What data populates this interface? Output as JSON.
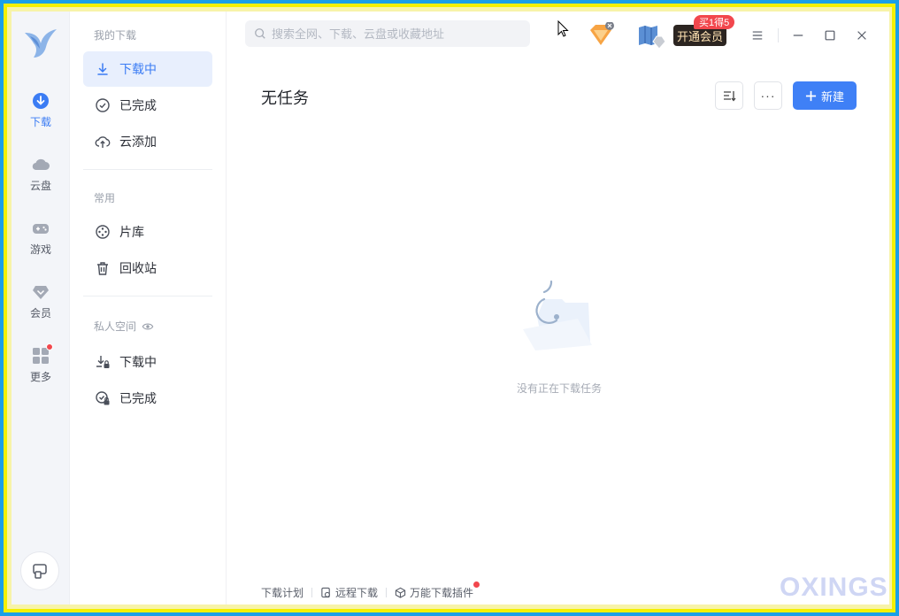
{
  "rail": {
    "items": [
      {
        "label": "下载",
        "icon": "download-circle-icon",
        "active": true
      },
      {
        "label": "云盘",
        "icon": "cloud-icon"
      },
      {
        "label": "游戏",
        "icon": "gamepad-icon"
      },
      {
        "label": "会员",
        "icon": "diamond-icon"
      },
      {
        "label": "更多",
        "icon": "apps-grid-icon",
        "badge_dot": true
      }
    ]
  },
  "side": {
    "my_downloads_title": "我的下载",
    "items_main": [
      {
        "label": "下载中",
        "icon": "download-arrow-icon",
        "active": true
      },
      {
        "label": "已完成",
        "icon": "check-circle-icon"
      },
      {
        "label": "云添加",
        "icon": "cloud-upload-icon"
      }
    ],
    "common_title": "常用",
    "items_common": [
      {
        "label": "片库",
        "icon": "film-reel-icon"
      },
      {
        "label": "回收站",
        "icon": "trash-icon"
      }
    ],
    "private_title": "私人空间",
    "items_private": [
      {
        "label": "下载中",
        "icon": "download-lock-icon"
      },
      {
        "label": "已完成",
        "icon": "check-lock-icon"
      }
    ]
  },
  "header": {
    "search_placeholder": "搜索全网、下载、云盘或收藏地址",
    "vip_button": "开通会员",
    "vip_badge": "买1得5"
  },
  "main": {
    "title": "无任务",
    "new_button": "新建",
    "more_button": "···",
    "empty_text": "没有正在下载任务"
  },
  "footer": {
    "items": [
      {
        "label": "下载计划"
      },
      {
        "label": "远程下载",
        "icon": "remote-icon"
      },
      {
        "label": "万能下载插件",
        "icon": "cube-icon",
        "badge_dot": true
      }
    ]
  },
  "watermark": "OXINGS",
  "colors": {
    "accent": "#3f80f6",
    "active_bg": "#e8effd",
    "badge_red": "#f2474d",
    "vip_dark": "#2c2521"
  }
}
